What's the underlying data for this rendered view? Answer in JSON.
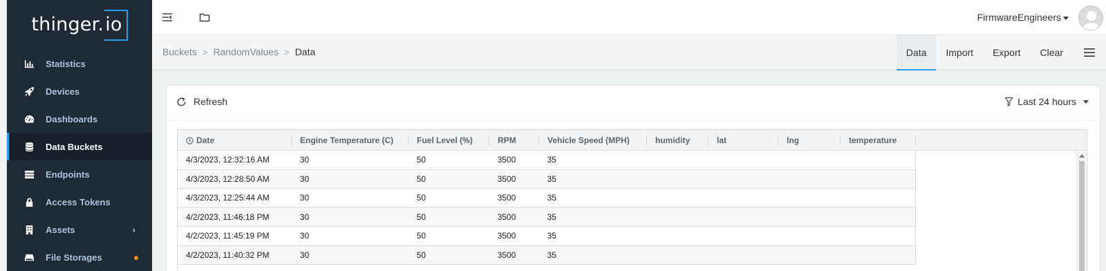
{
  "app": {
    "logo_text": "thinger.",
    "logo_box_text": "io"
  },
  "sidebar": {
    "items": [
      {
        "label": "Statistics",
        "icon": "bar-chart-icon"
      },
      {
        "label": "Devices",
        "icon": "rocket-icon"
      },
      {
        "label": "Dashboards",
        "icon": "gauge-icon"
      },
      {
        "label": "Data Buckets",
        "icon": "database-icon",
        "active": true
      },
      {
        "label": "Endpoints",
        "icon": "server-icon"
      },
      {
        "label": "Access Tokens",
        "icon": "lock-icon"
      },
      {
        "label": "Assets",
        "icon": "building-icon",
        "has_submenu": true
      },
      {
        "label": "File Storages",
        "icon": "hdd-icon",
        "badge_color": "#f08a1c"
      }
    ]
  },
  "topbar": {
    "user_name": "FirmwareEngineers"
  },
  "breadcrumb": {
    "items": [
      "Buckets",
      "RandomValues",
      "Data"
    ],
    "separator": ">"
  },
  "tabs": [
    {
      "label": "Data",
      "active": true
    },
    {
      "label": "Import"
    },
    {
      "label": "Export"
    },
    {
      "label": "Clear"
    }
  ],
  "panel": {
    "refresh_label": "Refresh",
    "filter_label": "Last 24 hours"
  },
  "table": {
    "columns": [
      "Date",
      "Engine Temperature (C)",
      "Fuel Level (%)",
      "RPM",
      "Vehicle Speed (MPH)",
      "humidity",
      "lat",
      "lng",
      "temperature"
    ],
    "rows": [
      [
        "4/3/2023, 12:32:16 AM",
        "30",
        "50",
        "3500",
        "35",
        "",
        "",
        "",
        ""
      ],
      [
        "4/3/2023, 12:28:50 AM",
        "30",
        "50",
        "3500",
        "35",
        "",
        "",
        "",
        ""
      ],
      [
        "4/3/2023, 12:25:44 AM",
        "30",
        "50",
        "3500",
        "35",
        "",
        "",
        "",
        ""
      ],
      [
        "4/2/2023, 11:46:18 PM",
        "30",
        "50",
        "3500",
        "35",
        "",
        "",
        "",
        ""
      ],
      [
        "4/2/2023, 11:45:19 PM",
        "30",
        "50",
        "3500",
        "35",
        "",
        "",
        "",
        ""
      ],
      [
        "4/2/2023, 11:40:32 PM",
        "30",
        "50",
        "3500",
        "35",
        "",
        "",
        "",
        ""
      ]
    ]
  },
  "colors": {
    "sidebar_bg": "#1e2a36",
    "accent": "#2c9de8",
    "nav_text": "#a9c3de"
  }
}
